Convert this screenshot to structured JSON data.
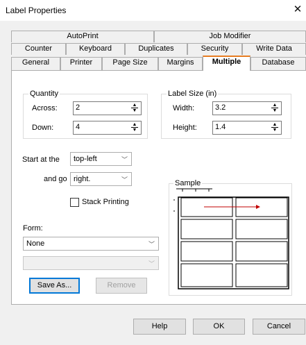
{
  "window": {
    "title": "Label Properties",
    "close_glyph": "✕"
  },
  "tabs_row1": [
    {
      "label": "AutoPrint"
    },
    {
      "label": "Job Modifier"
    }
  ],
  "tabs_row2": [
    {
      "label": "Counter"
    },
    {
      "label": "Keyboard"
    },
    {
      "label": "Duplicates"
    },
    {
      "label": "Security"
    },
    {
      "label": "Write Data"
    }
  ],
  "tabs_row3": [
    {
      "label": "General"
    },
    {
      "label": "Printer"
    },
    {
      "label": "Page Size"
    },
    {
      "label": "Margins"
    },
    {
      "label": "Multiple",
      "selected": true
    },
    {
      "label": "Database"
    }
  ],
  "quantity": {
    "group_label": "Quantity",
    "across_label": "Across:",
    "across_value": "2",
    "down_label": "Down:",
    "down_value": "4"
  },
  "label_size": {
    "group_label": "Label Size (in)",
    "width_label": "Width:",
    "width_value": "3.2",
    "height_label": "Height:",
    "height_value": "1.4"
  },
  "start_at": {
    "label": "Start at the",
    "value": "top-left"
  },
  "and_go": {
    "label": "and go",
    "value": "right."
  },
  "stack_printing": {
    "label": "Stack Printing",
    "checked": false
  },
  "form": {
    "label": "Form:",
    "value": "None",
    "second_value": ""
  },
  "buttons": {
    "save_as": "Save As...",
    "remove": "Remove",
    "help": "Help",
    "ok": "OK",
    "cancel": "Cancel"
  },
  "sample": {
    "group_label": "Sample",
    "columns": 2,
    "rows": 4,
    "arrow_color": "#c00000"
  },
  "icons": {
    "dropdown": "chevron-down-icon",
    "spin": "spin-arrows-icon",
    "close": "close-icon"
  }
}
